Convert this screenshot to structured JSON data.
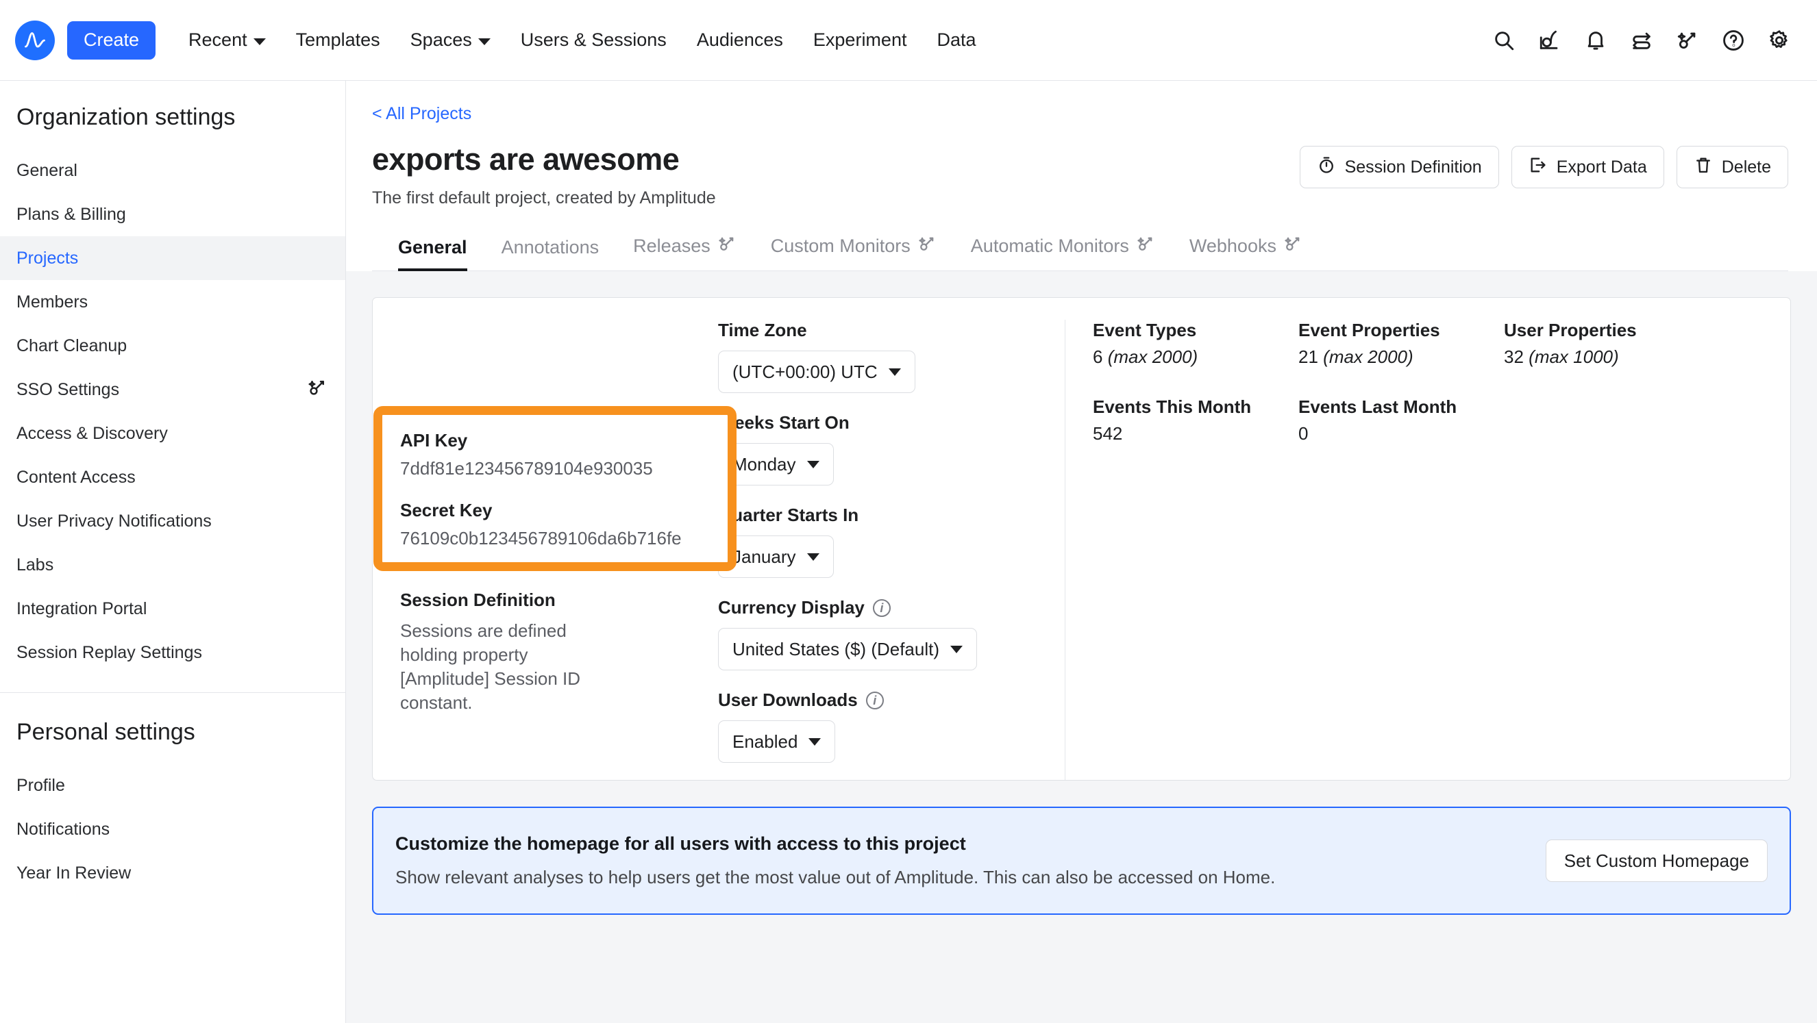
{
  "topnav": {
    "logo_icon": "amplitude-logo-icon",
    "create_label": "Create",
    "items": [
      {
        "label": "Recent",
        "has_chevron": true
      },
      {
        "label": "Templates",
        "has_chevron": false
      },
      {
        "label": "Spaces",
        "has_chevron": true
      },
      {
        "label": "Users & Sessions",
        "has_chevron": false
      },
      {
        "label": "Audiences",
        "has_chevron": false
      },
      {
        "label": "Experiment",
        "has_chevron": false
      },
      {
        "label": "Data",
        "has_chevron": false
      }
    ],
    "icons": [
      "search-icon",
      "analytics-icon",
      "notification-bell-icon",
      "swap-arrows-icon",
      "magic-key-icon",
      "help-circle-icon",
      "gear-icon"
    ]
  },
  "sidebar": {
    "org_heading": "Organization settings",
    "org_items": [
      {
        "label": "General",
        "active": false,
        "icon": null
      },
      {
        "label": "Plans & Billing",
        "active": false,
        "icon": null
      },
      {
        "label": "Projects",
        "active": true,
        "icon": null
      },
      {
        "label": "Members",
        "active": false,
        "icon": null
      },
      {
        "label": "Chart Cleanup",
        "active": false,
        "icon": null
      },
      {
        "label": "SSO Settings",
        "active": false,
        "icon": "magic-key-icon"
      },
      {
        "label": "Access & Discovery",
        "active": false,
        "icon": null
      },
      {
        "label": "Content Access",
        "active": false,
        "icon": null
      },
      {
        "label": "User Privacy Notifications",
        "active": false,
        "icon": null
      },
      {
        "label": "Labs",
        "active": false,
        "icon": null
      },
      {
        "label": "Integration Portal",
        "active": false,
        "icon": null
      },
      {
        "label": "Session Replay Settings",
        "active": false,
        "icon": null
      }
    ],
    "personal_heading": "Personal settings",
    "personal_items": [
      {
        "label": "Profile"
      },
      {
        "label": "Notifications"
      },
      {
        "label": "Year In Review"
      }
    ]
  },
  "main": {
    "breadcrumb": "< All Projects",
    "title": "exports are awesome",
    "subtitle": "The first default project, created by Amplitude",
    "actions": [
      {
        "label": "Session Definition",
        "icon": "stopwatch-icon"
      },
      {
        "label": "Export Data",
        "icon": "export-arrow-icon"
      },
      {
        "label": "Delete",
        "icon": "trash-icon"
      }
    ],
    "tabs": [
      {
        "label": "General",
        "active": true,
        "icon": null
      },
      {
        "label": "Annotations",
        "active": false,
        "icon": null
      },
      {
        "label": "Releases",
        "active": false,
        "icon": "magic-key-icon"
      },
      {
        "label": "Custom Monitors",
        "active": false,
        "icon": "magic-key-icon"
      },
      {
        "label": "Automatic Monitors",
        "active": false,
        "icon": "magic-key-icon"
      },
      {
        "label": "Webhooks",
        "active": false,
        "icon": "magic-key-icon"
      }
    ]
  },
  "card": {
    "highlight": {
      "accent_color": "#f7911e",
      "api_key_label": "API Key",
      "api_key_value": "7ddf81e123456789104e930035",
      "secret_key_label": "Secret Key",
      "secret_key_value": "76109c0b123456789106da6b716fe"
    },
    "session_definition_label": "Session Definition",
    "session_definition_text": "Sessions are defined holding property [Amplitude] Session ID constant.",
    "fields": [
      {
        "label": "Time Zone",
        "value": "(UTC+00:00) UTC",
        "info": false
      },
      {
        "label": "Weeks Start On",
        "value": "Monday",
        "info": false
      },
      {
        "label": "Quarter Starts In",
        "value": "January",
        "info": false
      },
      {
        "label": "Currency Display",
        "value": "United States ($) (Default)",
        "info": true
      },
      {
        "label": "User Downloads",
        "value": "Enabled",
        "info": true
      }
    ],
    "stats_row1": [
      {
        "label": "Event Types",
        "value": "6",
        "max": "(max 2000)"
      },
      {
        "label": "Event Properties",
        "value": "21",
        "max": "(max 2000)"
      },
      {
        "label": "User Properties",
        "value": "32",
        "max": "(max 1000)"
      }
    ],
    "stats_row2": [
      {
        "label": "Events This Month",
        "value": "542",
        "max": ""
      },
      {
        "label": "Events Last Month",
        "value": "0",
        "max": ""
      }
    ]
  },
  "banner": {
    "title": "Customize the homepage for all users with access to this project",
    "subtitle": "Show relevant analyses to help users get the most value out of Amplitude. This can also be accessed on Home.",
    "button_label": "Set Custom Homepage",
    "accent_color": "#2667ff"
  }
}
